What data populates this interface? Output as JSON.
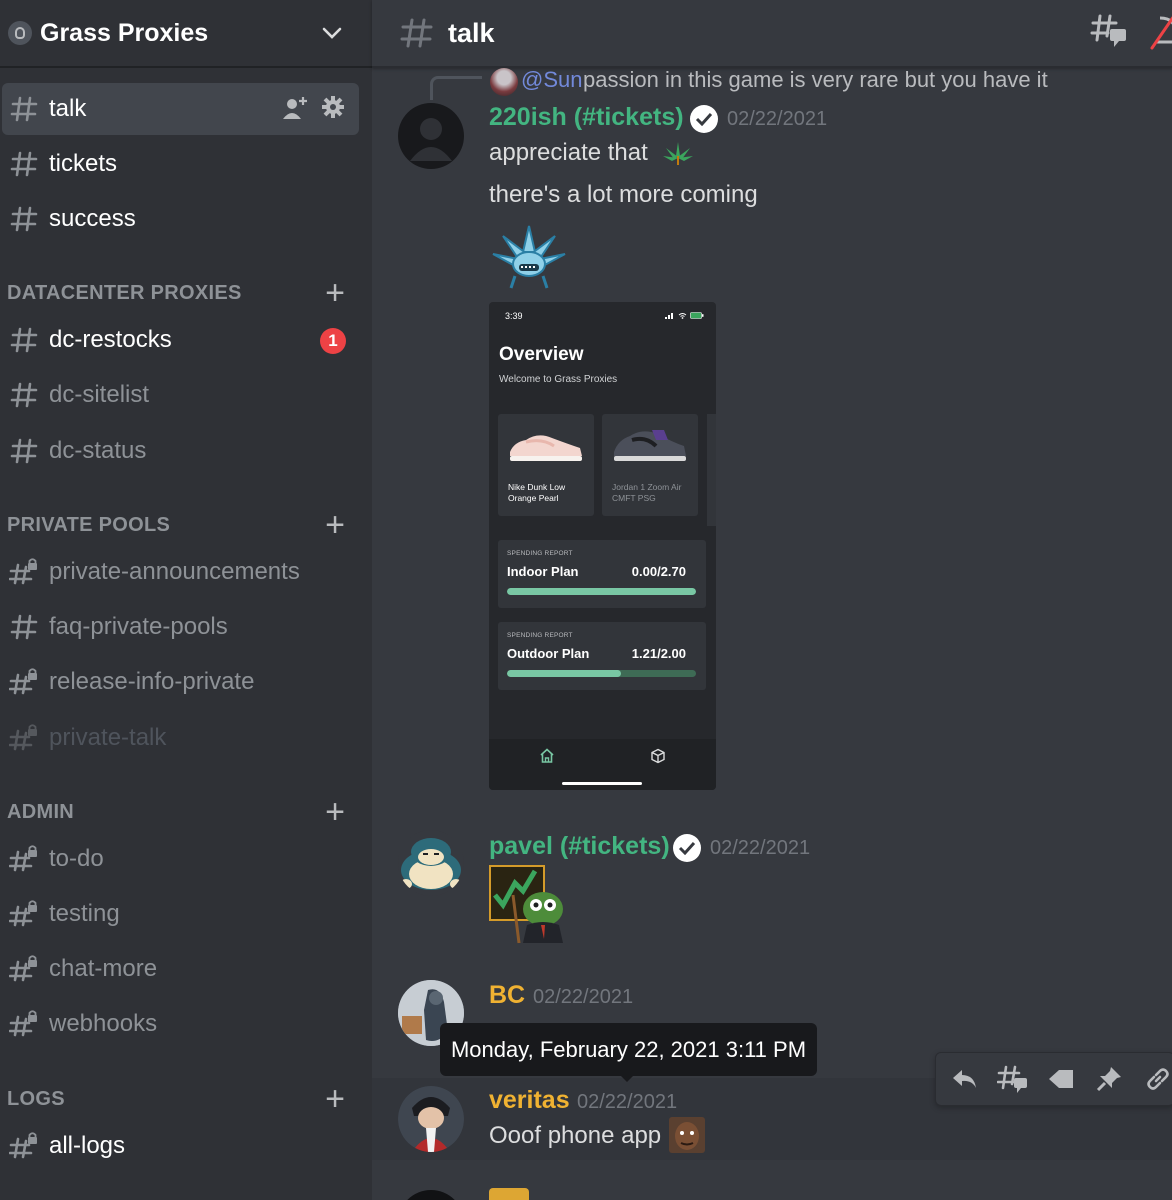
{
  "server": {
    "name": "Grass Proxies"
  },
  "channel_header": {
    "title": "talk"
  },
  "sidebar": {
    "top_channels": [
      {
        "name": "talk"
      },
      {
        "name": "tickets"
      },
      {
        "name": "success"
      }
    ],
    "categories": [
      {
        "label": "DATACENTER PROXIES",
        "channels": [
          {
            "name": "dc-restocks",
            "badge": "1"
          },
          {
            "name": "dc-sitelist"
          },
          {
            "name": "dc-status"
          }
        ]
      },
      {
        "label": "PRIVATE POOLS",
        "channels": [
          {
            "name": "private-announcements"
          },
          {
            "name": "faq-private-pools"
          },
          {
            "name": "release-info-private"
          },
          {
            "name": "private-talk"
          }
        ]
      },
      {
        "label": "ADMIN",
        "channels": [
          {
            "name": "to-do"
          },
          {
            "name": "testing"
          },
          {
            "name": "chat-more"
          },
          {
            "name": "webhooks"
          }
        ]
      },
      {
        "label": "LOGS",
        "channels": [
          {
            "name": "all-logs"
          }
        ]
      }
    ]
  },
  "messages": [
    {
      "reply": {
        "mention": "@Sun",
        "text": "passion in this game is very rare but you have it"
      },
      "author": "220ish (#tickets)",
      "timestamp": "02/22/2021",
      "lines": [
        "appreciate that",
        "there's a lot more coming"
      ],
      "attachment": {
        "status_time": "3:39",
        "title": "Overview",
        "subtitle": "Welcome to Grass Proxies",
        "products": [
          "Nike Dunk Low Orange Pearl",
          "Jordan 1 Zoom Air CMFT PSG"
        ],
        "reports": [
          {
            "tag": "SPENDING REPORT",
            "plan": "Indoor Plan",
            "value": "0.00/2.70",
            "fill": 1.0
          },
          {
            "tag": "SPENDING REPORT",
            "plan": "Outdoor Plan",
            "value": "1.21/2.00",
            "fill": 0.605
          }
        ]
      }
    },
    {
      "author": "pavel (#tickets)",
      "timestamp": "02/22/2021"
    },
    {
      "author": "BC",
      "timestamp": "02/22/2021"
    },
    {
      "author": "veritas",
      "timestamp": "02/22/2021",
      "text": "Ooof phone app"
    }
  ],
  "tooltip": {
    "text": "Monday, February 22, 2021 3:11 PM"
  },
  "colors": {
    "sidebar_bg": "#2f3136",
    "chat_bg": "#36393f",
    "green_role": "#43b581",
    "gold_role": "#f0b232",
    "mention_blue": "#7289da",
    "badge_red": "#ed4245"
  },
  "icons": [
    "chevron-down-icon",
    "hash-icon",
    "locked-hash-icon",
    "add-member-icon",
    "gear-icon",
    "threads-icon",
    "verified-icon",
    "reply-icon",
    "create-thread-icon",
    "tag-icon",
    "pin-icon",
    "link-icon"
  ]
}
